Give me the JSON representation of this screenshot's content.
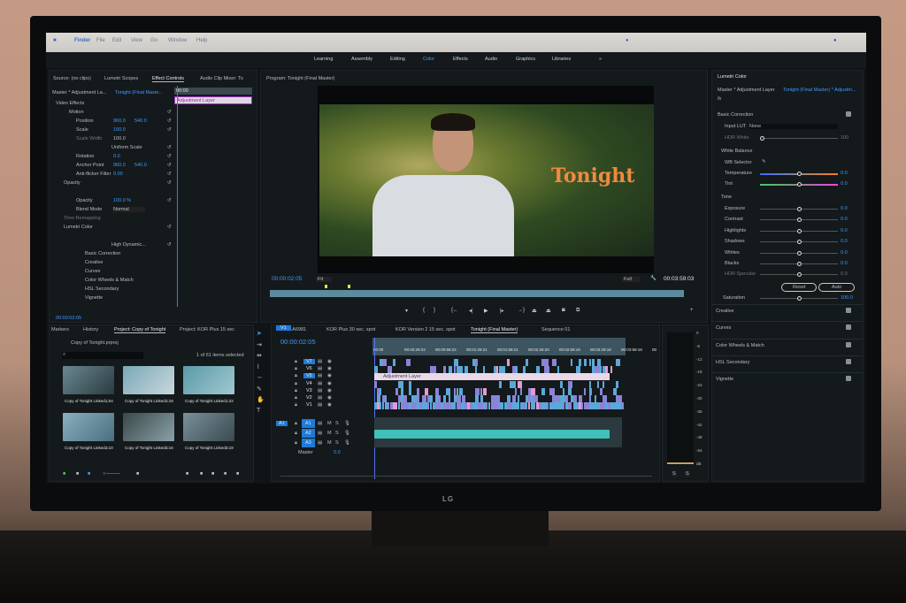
{
  "menubar": {
    "items": [
      "Finder",
      "File",
      "Edit",
      "View",
      "Go",
      "Window",
      "Help"
    ]
  },
  "workspaces": {
    "items": [
      "Learning",
      "Assembly",
      "Editing",
      "Color",
      "Effects",
      "Audio",
      "Graphics",
      "Libraries"
    ],
    "active": "Color",
    "more": "»"
  },
  "left_panel": {
    "tabs": [
      "Source: (no clips)",
      "Lumetri Scopes",
      "Effect Controls",
      "Audio Clip Mixer: To"
    ],
    "active_tab": "Effect Controls",
    "master": "Master * Adjustment La...",
    "sequence": "Tonight (Final Maste...",
    "timecode_ruler": "00:00",
    "clip_label": "Adjustment Layer",
    "section": "Video Effects",
    "rows": [
      {
        "label": "Motion",
        "v1": "",
        "v2": ""
      },
      {
        "label": "Position",
        "v1": "960.0",
        "v2": "540.0"
      },
      {
        "label": "Scale",
        "v1": "100.0",
        "v2": ""
      },
      {
        "label": "Scale Width",
        "v1": "100.0",
        "v2": ""
      },
      {
        "label": "Uniform Scale",
        "v1": "",
        "v2": ""
      },
      {
        "label": "Rotation",
        "v1": "0.0",
        "v2": ""
      },
      {
        "label": "Anchor Point",
        "v1": "960.0",
        "v2": "540.0"
      },
      {
        "label": "Anti-flicker Filter",
        "v1": "0.00",
        "v2": ""
      },
      {
        "label": "Opacity",
        "v1": "",
        "v2": ""
      },
      {
        "label": "Opacity",
        "v1": "100.0 %",
        "v2": ""
      },
      {
        "label": "Blend Mode",
        "v1": "Normal",
        "v2": ""
      },
      {
        "label": "Time Remapping",
        "v1": "",
        "v2": ""
      },
      {
        "label": "Lumetri Color",
        "v1": "",
        "v2": ""
      },
      {
        "label": "High Dynamic...",
        "v1": "",
        "v2": ""
      },
      {
        "label": "Basic Correction",
        "v1": "",
        "v2": ""
      },
      {
        "label": "Creative",
        "v1": "",
        "v2": ""
      },
      {
        "label": "Curves",
        "v1": "",
        "v2": ""
      },
      {
        "label": "Color Wheels & Match",
        "v1": "",
        "v2": ""
      },
      {
        "label": "HSL Secondary",
        "v1": "",
        "v2": ""
      },
      {
        "label": "Vignette",
        "v1": "",
        "v2": ""
      }
    ],
    "timecode": "00:00:02:05"
  },
  "program": {
    "title": "Program: Tonight (Final Master)",
    "overlay_text": "Tonight",
    "timecode": "00:00:02:05",
    "fit": "Fit",
    "quality": "Full",
    "duration": "00:03:59:03",
    "controls": [
      "marker",
      "in",
      "out",
      "go-in",
      "step-back",
      "play",
      "step-forward",
      "go-out",
      "lift",
      "extract",
      "export-frame",
      "compare",
      "add"
    ]
  },
  "lumetri": {
    "title": "Lumetri Color",
    "master": "Master * Adjustment Layer",
    "sequence": "Tonight (Final Master) * Adjustm...",
    "basic_correction": "Basic Correction",
    "input_lut_label": "Input LUT",
    "input_lut": "None",
    "hdr_white_label": "HDR White",
    "hdr_white": "100",
    "white_balance": "White Balance",
    "wb_selector": "WB Selector",
    "sliders": [
      {
        "label": "Temperature",
        "value": "0.0"
      },
      {
        "label": "Tint",
        "value": "0.0"
      }
    ],
    "tone": "Tone",
    "tone_sliders": [
      {
        "label": "Exposure",
        "value": "0.0"
      },
      {
        "label": "Contrast",
        "value": "0.0"
      },
      {
        "label": "Highlights",
        "value": "0.0"
      },
      {
        "label": "Shadows",
        "value": "0.0"
      },
      {
        "label": "Whites",
        "value": "0.0"
      },
      {
        "label": "Blacks",
        "value": "0.0"
      },
      {
        "label": "HDR Specular",
        "value": "0.0"
      }
    ],
    "reset": "Reset",
    "auto": "Auto",
    "saturation_label": "Saturation",
    "saturation": "100.0",
    "sections": [
      "Creative",
      "Curves",
      "Color Wheels & Match",
      "HSL Secondary",
      "Vignette"
    ]
  },
  "project": {
    "tabs": [
      "Markers",
      "History",
      "Project: Copy of Tonight",
      "Project: KOR Plus 15 sec"
    ],
    "active_tab": "Project: Copy of Tonight",
    "file": "Copy of Tonight.prproj",
    "selection": "1 of 61 items selected",
    "items": [
      {
        "name": "Copy of Tonight Linked...",
        "dur": "1:04"
      },
      {
        "name": "Copy of Tonight Linked...",
        "dur": "2:19"
      },
      {
        "name": "Copy of Tonight Linked...",
        "dur": "1:22"
      },
      {
        "name": "Copy of Tonight Linked...",
        "dur": "3:10"
      },
      {
        "name": "Copy of Tonight Linked...",
        "dur": "0:16"
      },
      {
        "name": "Copy of Tonight Linked...",
        "dur": "0:19"
      }
    ]
  },
  "timeline": {
    "tabs": [
      "961A6981",
      "KOR Plus 30 sec. spot",
      "KOR Version 2 15 sec. spot",
      "Tonight (Final Master)",
      "Sequence 01"
    ],
    "active_tab": "Tonight (Final Master)",
    "timecode": "00:00:02:05",
    "ruler": [
      "00:00",
      "00:00:29:23",
      "00:00:59:22",
      "00:01:29:21",
      "00:01:59:21",
      "00:02:29:20",
      "00:02:59:19",
      "00:03:29:18",
      "00:03:59:18",
      "00"
    ],
    "video_tracks": [
      "V7",
      "V6",
      "V5",
      "V4",
      "V3",
      "V2",
      "V1"
    ],
    "audio_tracks": [
      "A1",
      "A2",
      "A3"
    ],
    "source_video": "V1",
    "source_audio": "A1",
    "master_label": "Master",
    "master_value": "0.0",
    "adjustment_layer": "Adjustment Layer",
    "m": "M",
    "s": "S"
  },
  "meter": {
    "ticks": [
      "0",
      "-6",
      "-12",
      "-18",
      "-24",
      "-30",
      "-36",
      "-42",
      "-48",
      "-54",
      "dB"
    ],
    "solo": [
      "S",
      "S"
    ]
  },
  "brand": "LG",
  "colors": {
    "accent": "#3f9bff",
    "clip_blue": "#5aa9d8",
    "clip_violet": "#8a84d8",
    "clip_pink": "#e59ad0",
    "audio_teal": "#3fc0b8",
    "adjustment": "#e8d8e8"
  }
}
